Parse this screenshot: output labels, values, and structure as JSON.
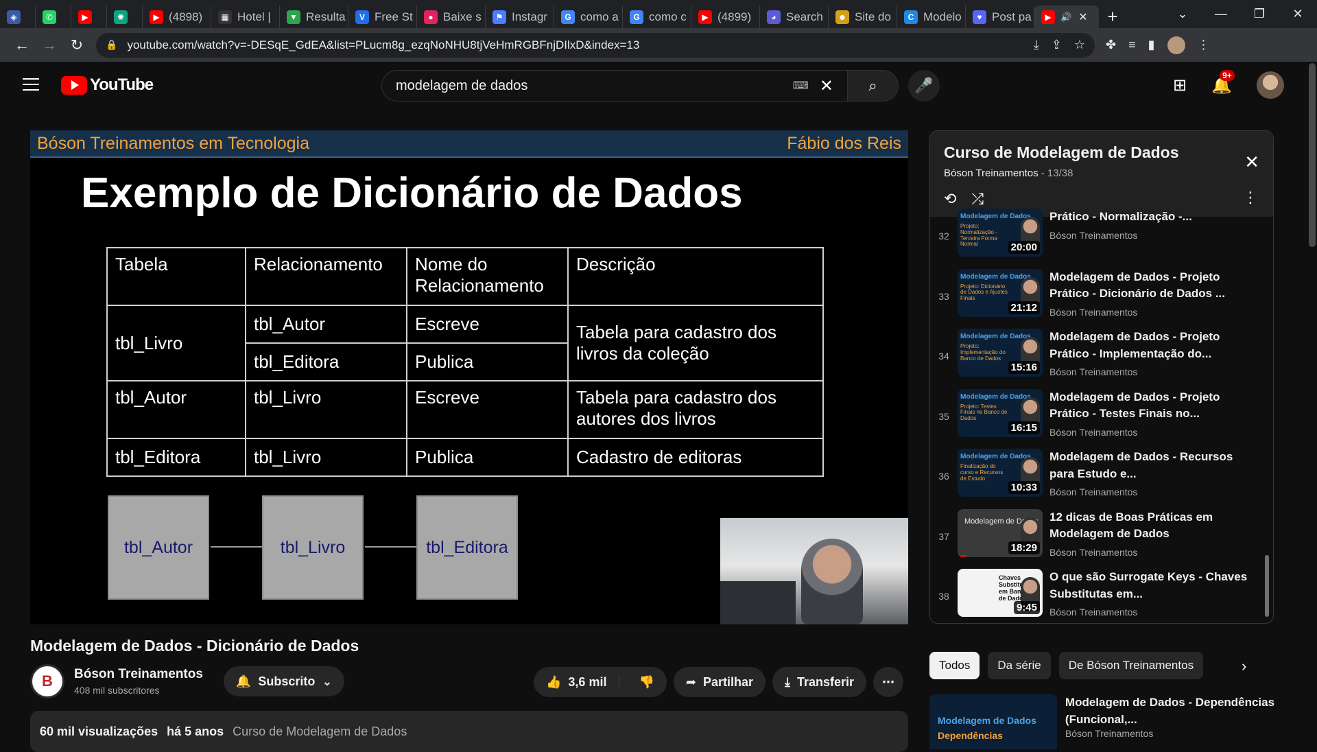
{
  "browser": {
    "tabs": [
      {
        "title": "",
        "color": "#3b5ba5",
        "glyph": "◈"
      },
      {
        "title": "",
        "color": "#25d366",
        "glyph": "✆"
      },
      {
        "title": "",
        "color": "#ff0000",
        "glyph": "▶"
      },
      {
        "title": "",
        "color": "#10a37f",
        "glyph": "✺"
      },
      {
        "title": "(4898)",
        "color": "#ff0000",
        "glyph": "▶"
      },
      {
        "title": "Hotel |",
        "color": "#333333",
        "glyph": "▦"
      },
      {
        "title": "Resulta",
        "color": "#2ea44f",
        "glyph": "▼"
      },
      {
        "title": "Free St",
        "color": "#1f6feb",
        "glyph": "V"
      },
      {
        "title": "Baixe s",
        "color": "#e0245e",
        "glyph": "●"
      },
      {
        "title": "Instagr",
        "color": "#4a7dff",
        "glyph": "⚑"
      },
      {
        "title": "como a",
        "color": "#4285f4",
        "glyph": "G"
      },
      {
        "title": "como c",
        "color": "#4285f4",
        "glyph": "G"
      },
      {
        "title": "(4899)",
        "color": "#ff0000",
        "glyph": "▶"
      },
      {
        "title": "Search",
        "color": "#5b5bd6",
        "glyph": "◕"
      },
      {
        "title": "Site do",
        "color": "#d4a017",
        "glyph": "☻"
      },
      {
        "title": "Modelo",
        "color": "#1e88e5",
        "glyph": "C"
      },
      {
        "title": "Post pa",
        "color": "#5865f2",
        "glyph": "♥"
      }
    ],
    "active_tab": {
      "title": "(",
      "color": "#ff0000",
      "glyph": "▶"
    },
    "url": "youtube.com/watch?v=-DESqE_GdEA&list=PLucm8g_ezqNoNHU8tjVeHmRGBFnjDIlxD&index=13"
  },
  "youtube": {
    "logo_text": "YouTube",
    "search_query": "modelagem de dados",
    "notifications_badge": "9+"
  },
  "slide": {
    "header_left": "Bóson Treinamentos em Tecnologia",
    "header_right": "Fábio dos Reis",
    "title": "Exemplo de Dicionário de Dados",
    "table": {
      "headers": [
        "Tabela",
        "Relacionamento",
        "Nome do Relacionamento",
        "Descrição"
      ],
      "livro": "tbl_Livro",
      "livro_rel1": "tbl_Autor",
      "livro_name1": "Escreve",
      "livro_rel2": "tbl_Editora",
      "livro_name2": "Publica",
      "livro_desc": "Tabela para cadastro dos livros da coleção",
      "autor": "tbl_Autor",
      "autor_rel": "tbl_Livro",
      "autor_name": "Escreve",
      "autor_desc": "Tabela para cadastro dos autores dos livros",
      "editora": "tbl_Editora",
      "editora_rel": "tbl_Livro",
      "editora_name": "Publica",
      "editora_desc": "Cadastro de editoras"
    },
    "diagram": [
      "tbl_Autor",
      "tbl_Livro",
      "tbl_Editora"
    ]
  },
  "video": {
    "title": "Modelagem de Dados - Dicionário de Dados",
    "channel": "Bóson Treinamentos",
    "subscribers": "408 mil subscritores",
    "subscribe_label": "Subscrito",
    "likes": "3,6 mil",
    "share_label": "Partilhar",
    "download_label": "Transferir",
    "views": "60 mil visualizações",
    "age": "há 5 anos",
    "playlist_tag": "Curso de Modelagem de Dados"
  },
  "playlist": {
    "title": "Curso de Modelagem de Dados",
    "channel": "Bóson Treinamentos",
    "position": "13/38",
    "items": [
      {
        "num": "32",
        "title": "Prático - Normalização -...",
        "channel": "Bóson Treinamentos",
        "duration": "20:00",
        "thumb_l1": "Modelagem de Dados",
        "thumb_l2": "Projeto: Normalização - Terceira Forma Normal"
      },
      {
        "num": "33",
        "title": "Modelagem de Dados - Projeto Prático - Dicionário de Dados ...",
        "channel": "Bóson Treinamentos",
        "duration": "21:12",
        "thumb_l1": "Modelagem de Dados",
        "thumb_l2": "Projeto: Dicionário de Dados e Ajustes Finais"
      },
      {
        "num": "34",
        "title": "Modelagem de Dados - Projeto Prático - Implementação do...",
        "channel": "Bóson Treinamentos",
        "duration": "15:16",
        "thumb_l1": "Modelagem de Dados",
        "thumb_l2": "Projeto: Implementação do Banco de Dados"
      },
      {
        "num": "35",
        "title": "Modelagem de Dados - Projeto Prático - Testes Finais no...",
        "channel": "Bóson Treinamentos",
        "duration": "16:15",
        "thumb_l1": "Modelagem de Dados",
        "thumb_l2": "Projeto: Testes Finais no Banco de Dados"
      },
      {
        "num": "36",
        "title": "Modelagem de Dados - Recursos para Estudo e...",
        "channel": "Bóson Treinamentos",
        "duration": "10:33",
        "thumb_l1": "Modelagem de Dados",
        "thumb_l2": "Finalização do curso e Recursos de Estudo"
      },
      {
        "num": "37",
        "title": "12 dicas de Boas Práticas em Modelagem de Dados",
        "channel": "Bóson Treinamentos",
        "duration": "18:29",
        "thumb_l1": "Modelagem de Dados",
        "thumb_l2": "",
        "progress": 0.1
      },
      {
        "num": "38",
        "title": "O que são Surrogate Keys - Chaves Substitutas em...",
        "channel": "Bóson Treinamentos",
        "duration": "9:45",
        "thumb_l1": "Chaves Substitutas em Bancos de Dados",
        "thumb_l2": ""
      }
    ]
  },
  "chips": [
    "Todos",
    "Da série",
    "De Bóson Treinamentos"
  ],
  "next_video": {
    "title": "Modelagem de Dados - Dependências (Funcional,...",
    "channel": "Bóson Treinamentos",
    "thumb_l1": "Modelagem de Dados",
    "thumb_l2": "Dependências"
  }
}
